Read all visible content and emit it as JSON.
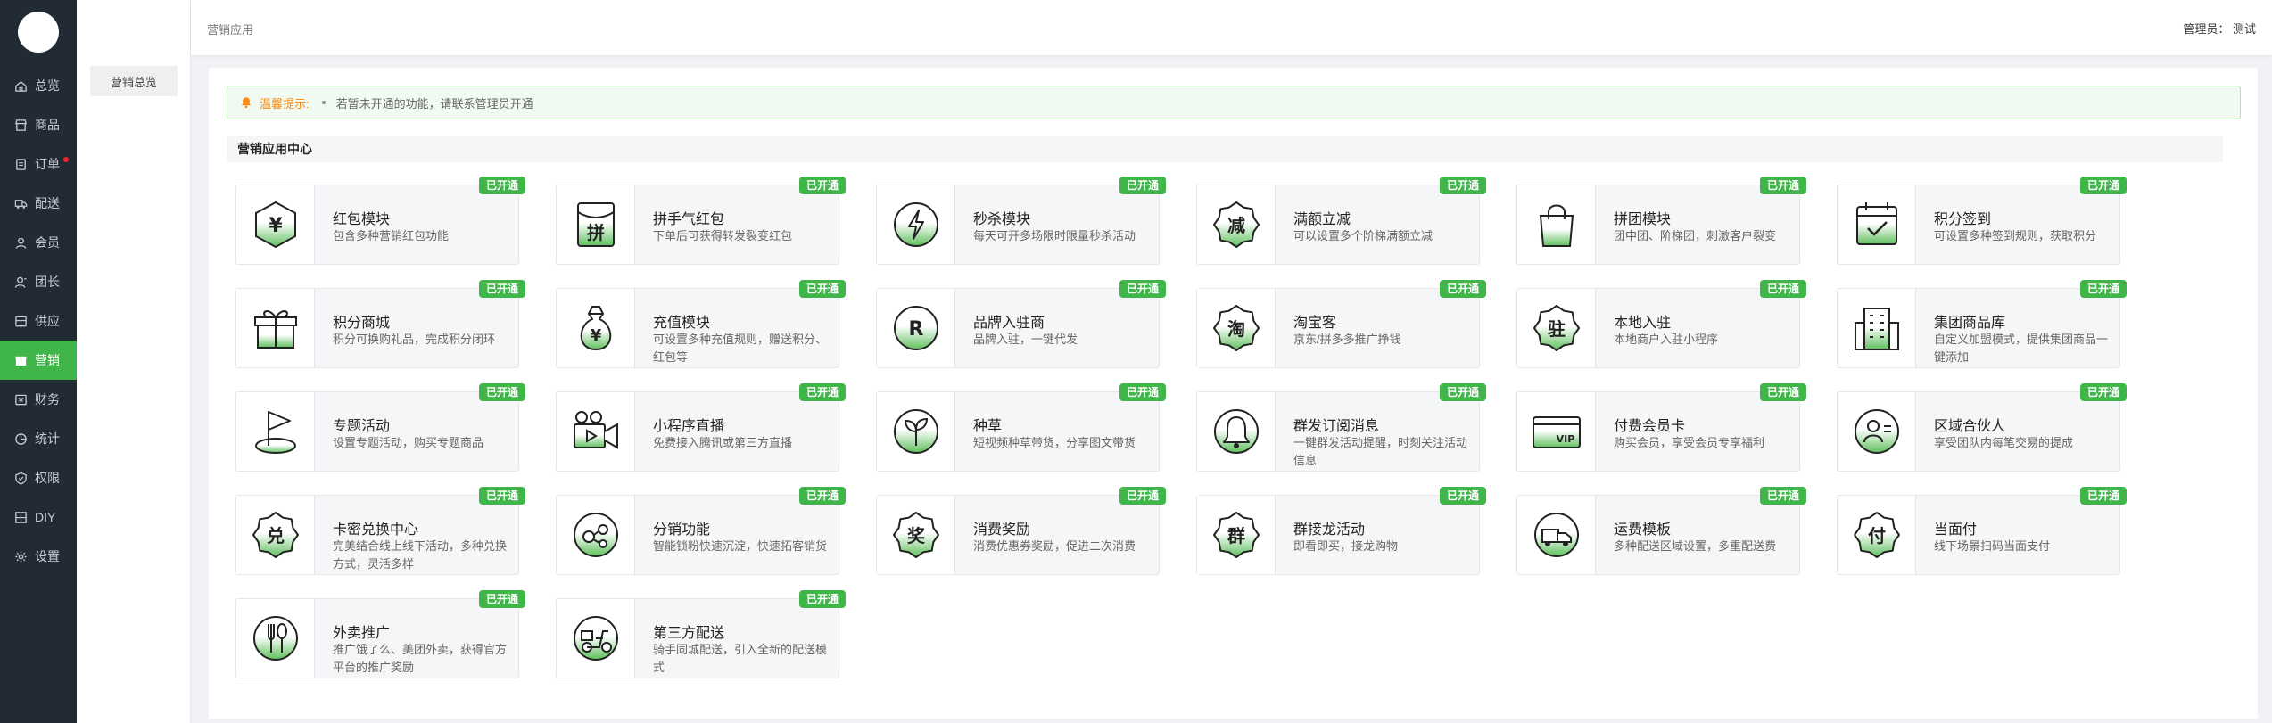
{
  "app": {
    "logo_text": ""
  },
  "nav": [
    {
      "label": "总览",
      "icon": "home-icon",
      "active": false,
      "dot": false
    },
    {
      "label": "商品",
      "icon": "shop-icon",
      "active": false,
      "dot": false
    },
    {
      "label": "订单",
      "icon": "order-icon",
      "active": false,
      "dot": true
    },
    {
      "label": "配送",
      "icon": "truck-icon",
      "active": false,
      "dot": false
    },
    {
      "label": "会员",
      "icon": "user-icon",
      "active": false,
      "dot": false
    },
    {
      "label": "团长",
      "icon": "leader-icon",
      "active": false,
      "dot": false
    },
    {
      "label": "供应",
      "icon": "supply-icon",
      "active": false,
      "dot": false
    },
    {
      "label": "营销",
      "icon": "marketing-icon",
      "active": true,
      "dot": false
    },
    {
      "label": "财务",
      "icon": "finance-icon",
      "active": false,
      "dot": false
    },
    {
      "label": "统计",
      "icon": "chart-icon",
      "active": false,
      "dot": false
    },
    {
      "label": "权限",
      "icon": "shield-icon",
      "active": false,
      "dot": false
    },
    {
      "label": "DIY",
      "icon": "diy-icon",
      "active": false,
      "dot": false
    },
    {
      "label": "设置",
      "icon": "gear-icon",
      "active": false,
      "dot": false
    }
  ],
  "subnav": {
    "active_label": "营销总览"
  },
  "header": {
    "breadcrumb": "营销应用",
    "admin": "管理员： 测试"
  },
  "notice": {
    "label": "温馨提示:",
    "text": "若暂未开通的功能，请联系管理员开通"
  },
  "section": {
    "title": "营销应用中心"
  },
  "badge_text": "已开通",
  "colors": {
    "accent": "#3fb54a",
    "sidebar": "#222a35",
    "notice": "#fa8c16"
  },
  "cards": [
    {
      "title": "红包模块",
      "desc": "包含多种营销红包功能",
      "icon": "yen-hexagon-icon",
      "glyph": "¥",
      "opened": true
    },
    {
      "title": "拼手气红包",
      "desc": "下单后可获得转发裂变红包",
      "icon": "lucky-packet-icon",
      "glyph": "拼",
      "opened": true
    },
    {
      "title": "秒杀模块",
      "desc": "每天可开多场限时限量秒杀活动",
      "icon": "flash-sale-icon",
      "glyph": "",
      "opened": true
    },
    {
      "title": "满额立减",
      "desc": "可以设置多个阶梯满额立减",
      "icon": "discount-badge-icon",
      "glyph": "减",
      "opened": true
    },
    {
      "title": "拼团模块",
      "desc": "团中团、阶梯团，刺激客户裂变",
      "icon": "shopping-bag-icon",
      "glyph": "",
      "opened": true
    },
    {
      "title": "积分签到",
      "desc": "可设置多种签到规则，获取积分",
      "icon": "calendar-check-icon",
      "glyph": "",
      "opened": true
    },
    {
      "title": "积分商城",
      "desc": "积分可换购礼品，完成积分闭环",
      "icon": "gift-icon",
      "glyph": "",
      "opened": true
    },
    {
      "title": "充值模块",
      "desc": "可设置多种充值规则，赠送积分、红包等",
      "icon": "money-bag-icon",
      "glyph": "¥",
      "opened": true
    },
    {
      "title": "品牌入驻商",
      "desc": "品牌入驻，一键代发",
      "icon": "brand-icon",
      "glyph": "R",
      "opened": true
    },
    {
      "title": "淘宝客",
      "desc": "京东/拼多多推广挣钱",
      "icon": "taobao-badge-icon",
      "glyph": "淘",
      "opened": true
    },
    {
      "title": "本地入驻",
      "desc": "本地商户入驻小程序",
      "icon": "local-badge-icon",
      "glyph": "驻",
      "opened": true
    },
    {
      "title": "集团商品库",
      "desc": "自定义加盟模式，提供集团商品一键添加",
      "icon": "building-icon",
      "glyph": "",
      "opened": true
    },
    {
      "title": "专题活动",
      "desc": "设置专题活动，购买专题商品",
      "icon": "flag-icon",
      "glyph": "",
      "opened": true
    },
    {
      "title": "小程序直播",
      "desc": "免费接入腾讯或第三方直播",
      "icon": "video-camera-icon",
      "glyph": "",
      "opened": true
    },
    {
      "title": "种草",
      "desc": "短视频种草带货，分享图文带货",
      "icon": "sprout-icon",
      "glyph": "",
      "opened": true
    },
    {
      "title": "群发订阅消息",
      "desc": "一键群发活动提醒，时刻关注活动信息",
      "icon": "bell-icon",
      "glyph": "",
      "opened": true
    },
    {
      "title": "付费会员卡",
      "desc": "购买会员，享受会员专享福利",
      "icon": "vip-card-icon",
      "glyph": "VIP",
      "opened": true
    },
    {
      "title": "区域合伙人",
      "desc": "享受团队内每笔交易的提成",
      "icon": "partner-icon",
      "glyph": "",
      "opened": true
    },
    {
      "title": "卡密兑换中心",
      "desc": "完美结合线上线下活动，多种兑换方式，灵活多样",
      "icon": "exchange-badge-icon",
      "glyph": "兑",
      "opened": true
    },
    {
      "title": "分销功能",
      "desc": "智能锁粉快速沉淀，快速拓客销货",
      "icon": "distribution-icon",
      "glyph": "",
      "opened": true
    },
    {
      "title": "消费奖励",
      "desc": "消费优惠券奖励，促进二次消费",
      "icon": "reward-badge-icon",
      "glyph": "奖",
      "opened": true
    },
    {
      "title": "群接龙活动",
      "desc": "即看即买，接龙购物",
      "icon": "group-badge-icon",
      "glyph": "群",
      "opened": true
    },
    {
      "title": "运费模板",
      "desc": "多种配送区域设置，多重配送费",
      "icon": "delivery-truck-icon",
      "glyph": "",
      "opened": true
    },
    {
      "title": "当面付",
      "desc": "线下场景扫码当面支付",
      "icon": "pay-badge-icon",
      "glyph": "付",
      "opened": true
    },
    {
      "title": "外卖推广",
      "desc": "推广饿了么、美团外卖，获得官方平台的推广奖励",
      "icon": "fork-spoon-icon",
      "glyph": "",
      "opened": true
    },
    {
      "title": "第三方配送",
      "desc": "骑手同城配送，引入全新的配送模式",
      "icon": "scooter-icon",
      "glyph": "",
      "opened": true
    }
  ]
}
